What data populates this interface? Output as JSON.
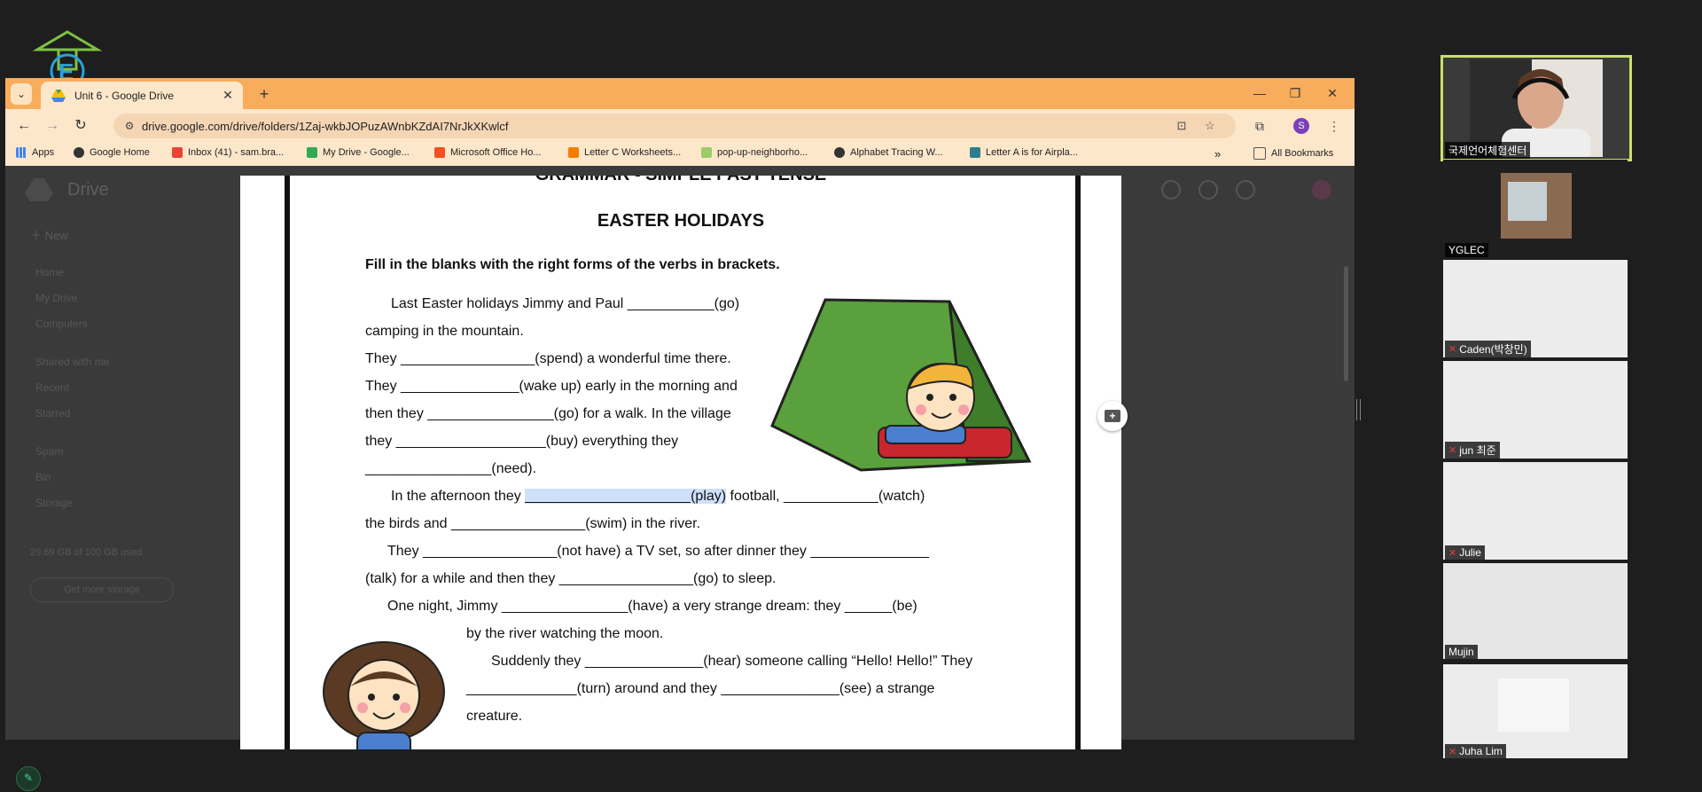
{
  "browser": {
    "tab_title": "Unit 6 - Google Drive",
    "url": "drive.google.com/drive/folders/1Zaj-wkbJOPuzAWnbKZdAI7NrJkXKwlcf",
    "profile_initial": "S",
    "bookmarks": [
      {
        "label": "Apps",
        "icon": "apps-grid-icon"
      },
      {
        "label": "Google Home",
        "icon": "globe-icon"
      },
      {
        "label": "Inbox (41) - sam.bra...",
        "icon": "gmail-icon"
      },
      {
        "label": "My Drive - Google...",
        "icon": "drive-icon"
      },
      {
        "label": "Microsoft Office Ho...",
        "icon": "office-icon"
      },
      {
        "label": "Letter C Worksheets...",
        "icon": "worksheet-icon"
      },
      {
        "label": "pop-up-neighborho...",
        "icon": "tag-icon"
      },
      {
        "label": "Alphabet Tracing W...",
        "icon": "globe-icon"
      },
      {
        "label": "Letter A is for Airpla...",
        "icon": "s-icon"
      }
    ],
    "all_bookmarks_label": "All Bookmarks"
  },
  "drive": {
    "brand": "Drive",
    "new_label": "New",
    "nav": [
      "Home",
      "My Drive",
      "Computers",
      "Shared with me",
      "Recent",
      "Starred",
      "Spam",
      "Bin",
      "Storage"
    ],
    "storage_text": "29.69 GB of 100 GB used",
    "storage_button": "Get more storage"
  },
  "worksheet": {
    "cut_header": "GRAMMAR - SIMPLE PAST TENSE",
    "title": "EASTER HOLIDAYS",
    "instructions": "Fill in the blanks with the right forms of the verbs in brackets.",
    "lines": [
      "Last Easter holidays Jimmy and Paul ___________(go)",
      "camping in the mountain.",
      "They _________________(spend) a wonderful time there.",
      "They _______________(wake up)  early in the morning and",
      "then they ________________(go) for a walk. In the village",
      "they ___________________(buy) everything they",
      "________________(need).",
      "In the afternoon they ",
      "_____________________",
      "(play)",
      " football, ____________(watch)",
      "the birds and _________________(swim) in the river.",
      "They _________________(not have) a TV set, so after dinner they _______________",
      "(talk) for a while and then they _________________(go) to sleep.",
      "One night, Jimmy ________________(have)  a very strange dream: they ______(be)",
      "by the river watching the moon.",
      "Suddenly they _______________(hear) someone calling “Hello! Hello!” They",
      "______________(turn) around and they _______________(see) a strange",
      "creature."
    ]
  },
  "participants": [
    {
      "name": "국제언어체험센터",
      "muted": false
    },
    {
      "name": "YGLEC",
      "muted": false
    },
    {
      "name": "Caden(박창민)",
      "muted": true
    },
    {
      "name": "jun 최준",
      "muted": true
    },
    {
      "name": "Julie",
      "muted": true
    },
    {
      "name": "Mujin",
      "muted": false
    },
    {
      "name": "Juha Lim",
      "muted": true
    }
  ],
  "colors": {
    "tab_bar": "#f7ad5c",
    "toolbar": "#fde7cb",
    "highlight": "#cfe1fa",
    "active_speaker": "#c8e06b"
  }
}
